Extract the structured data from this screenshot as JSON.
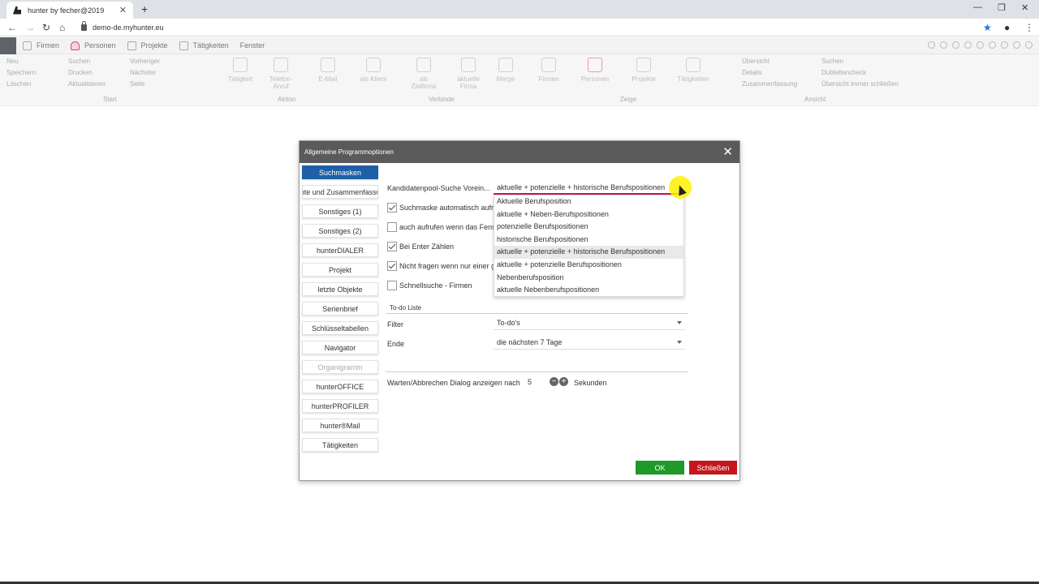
{
  "browser": {
    "tab_title": "hunter by fecher@2019",
    "url": "demo-de.myhunter.eu",
    "tab_close": "✕",
    "new_tab": "+",
    "minimize": "—",
    "restore": "❐",
    "win_close": "✕"
  },
  "menubar": {
    "items": [
      {
        "label": "Firmen",
        "icon": "building-icon"
      },
      {
        "label": "Personen",
        "icon": "person-icon"
      },
      {
        "label": "Projekte",
        "icon": "project-icon"
      },
      {
        "label": "Tätigkeiten",
        "icon": "calendar-icon"
      },
      {
        "label": "Fenster",
        "icon": ""
      }
    ]
  },
  "ribbon": {
    "start": {
      "neu": "Neu",
      "speichern": "Speichern",
      "loeschen": "Löschen",
      "suchen": "Suchen",
      "drucken": "Drucken",
      "aktualisieren": "Aktualisieren",
      "vorheriger": "Vorheriger",
      "naechster": "Nächster",
      "seite": "Seite"
    },
    "aktion": {
      "taetigkeit": "Tätigkeit",
      "telefon": "Telefon-Anruf",
      "email": "E-Mail"
    },
    "verbinde": {
      "klient": "als Klient",
      "zielfirma": "als Zielfirma",
      "aktuelle_firma": "aktuelle Firma",
      "merge": "Merge"
    },
    "zeige": {
      "firmen": "Firmen",
      "personen": "Personen",
      "projekte": "Projekte",
      "taetigkeiten": "Tätigkeiten"
    },
    "ansicht": {
      "uebersicht": "Übersicht",
      "details": "Details",
      "zusammenfassung": "Zusammenfassung",
      "suchen": "Suchen",
      "dublettencheck": "Dublettencheck",
      "uebersicht_schliessen": "Übersicht immer schließen"
    },
    "groups": {
      "start": "Start",
      "aktion": "Aktion",
      "verbinde": "Verbinde",
      "zeige": "Zeige",
      "ansicht": "Ansicht"
    }
  },
  "dialog": {
    "title": "Allgemeine Programmoptionen",
    "close": "✕",
    "sidebar": [
      {
        "label": "Suchmasken",
        "state": "active"
      },
      {
        "label": "Berichte und Zusammenfassungen",
        "state": ""
      },
      {
        "label": "Sonstiges (1)",
        "state": ""
      },
      {
        "label": "Sonstiges (2)",
        "state": ""
      },
      {
        "label": "hunterDIALER",
        "state": ""
      },
      {
        "label": "Projekt",
        "state": ""
      },
      {
        "label": "letzte Objekte",
        "state": ""
      },
      {
        "label": "Serienbrief",
        "state": ""
      },
      {
        "label": "Schlüsseltabellen",
        "state": ""
      },
      {
        "label": "Navigator",
        "state": ""
      },
      {
        "label": "Organigramm",
        "state": "disabled"
      },
      {
        "label": "hunterOFFICE",
        "state": ""
      },
      {
        "label": "hunterPROFILER",
        "state": ""
      },
      {
        "label": "hunter®Mail",
        "state": ""
      },
      {
        "label": "Tätigkeiten",
        "state": ""
      }
    ],
    "pool_label": "Kandidatenpool-Suche Vorein...",
    "pool_value": "aktuelle + potenzielle + historische Berufspositionen",
    "checkboxes": [
      {
        "label": "Suchmaske automatisch aufrufen",
        "checked": true
      },
      {
        "label": "auch aufrufen wenn das Fenster",
        "checked": false
      },
      {
        "label": "Bei Enter Zählen",
        "checked": true
      },
      {
        "label": "Nicht fragen wenn nur einer gefunden",
        "checked": true
      },
      {
        "label": "Schnellsuche - Firmen",
        "checked": false
      }
    ],
    "dropdown_options": [
      "Aktuelle Berufsposition",
      "aktuelle + Neben-Berufspositionen",
      "potenzielle Berufspositionen",
      "historische Berufspositionen",
      "aktuelle + potenzielle + historische Berufspositionen",
      "aktuelle + potenzielle Berufspositionen",
      "Nebenberufsposition",
      "aktuelle Nebenberufspositionen"
    ],
    "todo_title": "To-do Liste",
    "filter_label": "Filter",
    "filter_value": "To-do's",
    "ende_label": "Ende",
    "ende_value": "die nächsten 7 Tage",
    "warten_label": "Warten/Abbrechen Dialog anzeigen nach",
    "warten_value": "5",
    "sekunden": "Sekunden",
    "minus": "−",
    "plus": "+",
    "ok": "OK",
    "schliessen": "Schließen"
  }
}
